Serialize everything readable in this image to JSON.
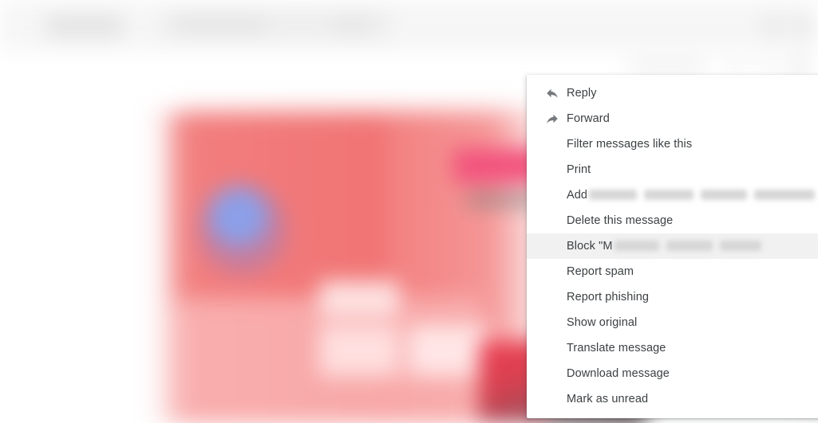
{
  "app": {
    "title": "Mail message view",
    "background_note": "blurred email client behind context menu"
  },
  "appbar": {
    "search_placeholder": "",
    "icons": [
      {
        "name": "apps-icon"
      },
      {
        "name": "account-avatar"
      }
    ]
  },
  "message_toolbar": {
    "timestamp": "",
    "icons": [
      {
        "name": "add-reaction-icon"
      },
      {
        "name": "reply-icon"
      },
      {
        "name": "more-options-icon"
      }
    ]
  },
  "context_menu": {
    "name": "message-more-options-menu",
    "items": [
      {
        "id": "reply",
        "label": "Reply",
        "icon": "reply-icon",
        "selected": false,
        "redacted": null
      },
      {
        "id": "forward",
        "label": "Forward",
        "icon": "forward-icon",
        "selected": false,
        "redacted": null
      },
      {
        "id": "filter-messages",
        "label": "Filter messages like this",
        "icon": null,
        "selected": false,
        "redacted": null
      },
      {
        "id": "print",
        "label": "Print",
        "icon": null,
        "selected": false,
        "redacted": null
      },
      {
        "id": "add-to-contacts",
        "label": "Add",
        "icon": null,
        "selected": false,
        "redacted": "sender-name-and-contacts-list"
      },
      {
        "id": "delete-message",
        "label": "Delete this message",
        "icon": null,
        "selected": false,
        "redacted": null
      },
      {
        "id": "block-sender",
        "label": "Block \"M",
        "icon": null,
        "selected": true,
        "redacted": "sender-name"
      },
      {
        "id": "report-spam",
        "label": "Report spam",
        "icon": null,
        "selected": false,
        "redacted": null
      },
      {
        "id": "report-phishing",
        "label": "Report phishing",
        "icon": null,
        "selected": false,
        "redacted": null
      },
      {
        "id": "show-original",
        "label": "Show original",
        "icon": null,
        "selected": false,
        "redacted": null
      },
      {
        "id": "translate-message",
        "label": "Translate message",
        "icon": null,
        "selected": false,
        "redacted": null
      },
      {
        "id": "download-message",
        "label": "Download message",
        "icon": null,
        "selected": false,
        "redacted": null
      },
      {
        "id": "mark-as-unread",
        "label": "Mark as unread",
        "icon": null,
        "selected": false,
        "redacted": null
      }
    ]
  },
  "colors": {
    "menu_background": "#ffffff",
    "menu_text": "#3c4043",
    "menu_highlight": "#f1f1f1",
    "icon": "#5f6368",
    "promo_pink": "#f38080",
    "promo_accent": "#f2537d",
    "promo_blue_dot": "#8c9fe8",
    "app_bar": "#f6f6f6"
  }
}
